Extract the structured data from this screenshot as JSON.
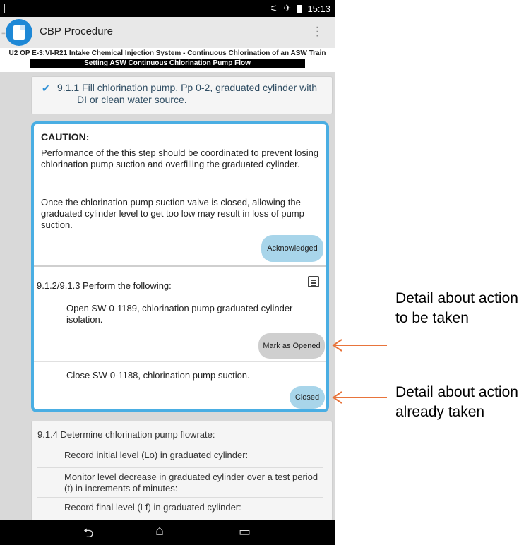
{
  "status": {
    "time": "15:13"
  },
  "app": {
    "title": "CBP Procedure"
  },
  "procedure": {
    "title": "U2 OP E-3:VI-R21 Intake Chemical Injection System - Continuous Chlorination of an ASW Train",
    "section": "Setting ASW Continuous Chlorination Pump Flow"
  },
  "step_911": {
    "line1": "9.1.1 Fill chlorination pump, Pp 0-2, graduated cylinder with",
    "line2": "DI or clean water source."
  },
  "caution": {
    "title": "CAUTION:",
    "p1": "Performance of the this step should be coordinated to prevent losing chlorination pump suction and overfilling the graduated cylinder.",
    "p2": "Once the chlorination pump suction valve is closed, allowing the graduated cylinder level to get too low may result in loss of pump suction.",
    "ack_label": "Acknowledged"
  },
  "step_912": {
    "label": "9.1.2/9.1.3 Perform the following:",
    "open_text": "Open SW-0-1189, chlorination pump graduated cylinder isolation.",
    "open_button": "Mark as Opened",
    "close_text": "Close SW-0-1188, chlorination pump suction.",
    "close_button": "Closed"
  },
  "step_914": {
    "label": "9.1.4 Determine chlorination pump flowrate:",
    "rows": [
      "Record initial level (Lo) in graduated cylinder:",
      "Monitor level decrease in graduated cylinder over a test period (t) in increments of minutes:",
      "Record final level (Lf) in graduated cylinder:"
    ]
  },
  "annotations": {
    "note1": "Detail about action to be taken",
    "note2": "Detail about action already taken",
    "arrow_color": "#e8743b"
  }
}
